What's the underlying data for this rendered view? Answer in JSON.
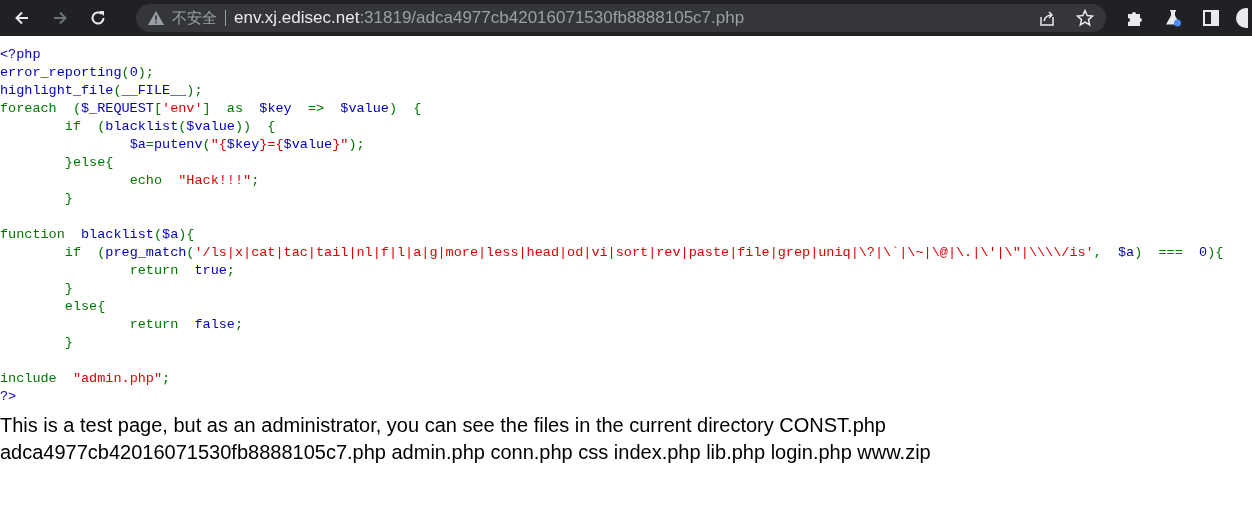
{
  "browser": {
    "back": {
      "disabled": false
    },
    "forward": {
      "disabled": true
    },
    "address": {
      "security_label": "不安全",
      "host": "env.xj.edisec.net",
      "path": ":31819/adca4977cb42016071530fb8888105c7.php"
    }
  },
  "code": [
    {
      "kind": "code",
      "tokens": [
        {
          "text": "<?php",
          "kind": "default"
        }
      ]
    },
    {
      "kind": "code",
      "tokens": [
        {
          "text": "error_reporting",
          "kind": "default"
        },
        {
          "text": "(",
          "kind": "keyword"
        },
        {
          "text": "0",
          "kind": "default"
        },
        {
          "text": ");",
          "kind": "keyword"
        }
      ]
    },
    {
      "kind": "code",
      "tokens": [
        {
          "text": "highlight_file",
          "kind": "default"
        },
        {
          "text": "(",
          "kind": "keyword"
        },
        {
          "text": "__FILE__",
          "kind": "default"
        },
        {
          "text": ");",
          "kind": "keyword"
        }
      ]
    },
    {
      "kind": "code",
      "tokens": [
        {
          "text": "foreach  (",
          "kind": "keyword"
        },
        {
          "text": "$_REQUEST",
          "kind": "default"
        },
        {
          "text": "[",
          "kind": "keyword"
        },
        {
          "text": "'env'",
          "kind": "string"
        },
        {
          "text": "]  as  ",
          "kind": "keyword"
        },
        {
          "text": "$key  ",
          "kind": "default"
        },
        {
          "text": "=>  ",
          "kind": "keyword"
        },
        {
          "text": "$value",
          "kind": "default"
        },
        {
          "text": ")  {",
          "kind": "keyword"
        }
      ]
    },
    {
      "kind": "code",
      "tokens": [
        {
          "text": "\tif  (",
          "kind": "keyword"
        },
        {
          "text": "blacklist",
          "kind": "default"
        },
        {
          "text": "(",
          "kind": "keyword"
        },
        {
          "text": "$value",
          "kind": "default"
        },
        {
          "text": "))  {",
          "kind": "keyword"
        }
      ]
    },
    {
      "kind": "code",
      "tokens": [
        {
          "text": "\t\t$a",
          "kind": "default"
        },
        {
          "text": "=",
          "kind": "keyword"
        },
        {
          "text": "putenv",
          "kind": "default"
        },
        {
          "text": "(",
          "kind": "keyword"
        },
        {
          "text": "\"{",
          "kind": "string"
        },
        {
          "text": "$key",
          "kind": "default"
        },
        {
          "text": "}={",
          "kind": "string"
        },
        {
          "text": "$value",
          "kind": "default"
        },
        {
          "text": "}\"",
          "kind": "string"
        },
        {
          "text": ");",
          "kind": "keyword"
        }
      ]
    },
    {
      "kind": "code",
      "tokens": [
        {
          "text": "\t}else{",
          "kind": "keyword"
        }
      ]
    },
    {
      "kind": "code",
      "tokens": [
        {
          "text": "\t\techo  ",
          "kind": "keyword"
        },
        {
          "text": "\"Hack!!!\"",
          "kind": "string"
        },
        {
          "text": ";",
          "kind": "keyword"
        }
      ]
    },
    {
      "kind": "code",
      "tokens": [
        {
          "text": "\t}",
          "kind": "keyword"
        }
      ]
    },
    {
      "kind": "blank"
    },
    {
      "kind": "code",
      "tokens": [
        {
          "text": "function  ",
          "kind": "keyword"
        },
        {
          "text": "blacklist",
          "kind": "default"
        },
        {
          "text": "(",
          "kind": "keyword"
        },
        {
          "text": "$a",
          "kind": "default"
        },
        {
          "text": "){",
          "kind": "keyword"
        }
      ]
    },
    {
      "kind": "code",
      "tokens": [
        {
          "text": "\tif  (",
          "kind": "keyword"
        },
        {
          "text": "preg_match",
          "kind": "default"
        },
        {
          "text": "(",
          "kind": "keyword"
        },
        {
          "text": "'/ls|x|cat|tac|tail|nl|f|l|a|g|more|less|head|od|vi|sort|rev|paste|file|grep|uniq|\\?|\\`|\\~|\\@|\\.|\\'|\\\"|\\\\\\\\/is'",
          "kind": "string"
        },
        {
          "text": ",  ",
          "kind": "keyword"
        },
        {
          "text": "$a",
          "kind": "default"
        },
        {
          "text": ")  ===  ",
          "kind": "keyword"
        },
        {
          "text": "0",
          "kind": "default"
        },
        {
          "text": "){",
          "kind": "keyword"
        }
      ]
    },
    {
      "kind": "code",
      "tokens": [
        {
          "text": "\t\treturn  ",
          "kind": "keyword"
        },
        {
          "text": "true",
          "kind": "default"
        },
        {
          "text": ";",
          "kind": "keyword"
        }
      ]
    },
    {
      "kind": "code",
      "tokens": [
        {
          "text": "\t}",
          "kind": "keyword"
        }
      ]
    },
    {
      "kind": "code",
      "tokens": [
        {
          "text": "\telse{",
          "kind": "keyword"
        }
      ]
    },
    {
      "kind": "code",
      "tokens": [
        {
          "text": "\t\treturn  ",
          "kind": "keyword"
        },
        {
          "text": "false",
          "kind": "default"
        },
        {
          "text": ";",
          "kind": "keyword"
        }
      ]
    },
    {
      "kind": "code",
      "tokens": [
        {
          "text": "\t}",
          "kind": "keyword"
        }
      ]
    },
    {
      "kind": "blank"
    },
    {
      "kind": "code",
      "tokens": [
        {
          "text": "include  ",
          "kind": "keyword"
        },
        {
          "text": "\"admin.php\"",
          "kind": "string"
        },
        {
          "text": ";",
          "kind": "keyword"
        }
      ]
    },
    {
      "kind": "code",
      "tokens": [
        {
          "text": "?>",
          "kind": "default"
        }
      ]
    }
  ],
  "message": [
    "This is a test page, but as an administrator, you can see the files in the current directory CONST.php",
    "adca4977cb42016071530fb8888105c7.php admin.php conn.php css index.php lib.php login.php www.zip"
  ]
}
